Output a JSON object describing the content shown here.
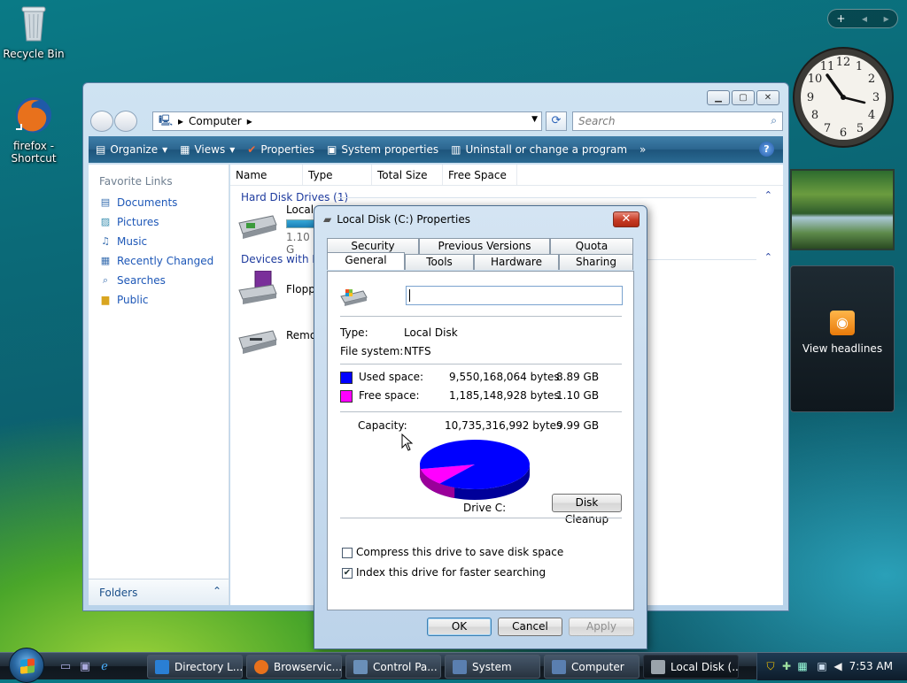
{
  "desktop": {
    "icons": [
      {
        "label": "Recycle Bin"
      },
      {
        "label": "firefox -\nShortcut",
        "line1": "firefox -",
        "line2": "Shortcut"
      }
    ]
  },
  "explorer": {
    "address": {
      "location": "Computer",
      "arrow": "▸"
    },
    "search_placeholder": "Search",
    "toolbar": {
      "organize": "Organize",
      "views": "Views",
      "properties": "Properties",
      "system_properties": "System properties",
      "uninstall": "Uninstall or change a program",
      "more": "»"
    },
    "nav": {
      "header": "Favorite Links",
      "links": [
        "Documents",
        "Pictures",
        "Music",
        "Recently Changed",
        "Searches",
        "Public"
      ],
      "folders": "Folders"
    },
    "columns": [
      "Name",
      "Type",
      "Total Size",
      "Free Space"
    ],
    "groups": [
      {
        "title": "Hard Disk Drives (1)"
      },
      {
        "title": "Devices with Re"
      }
    ],
    "items": [
      {
        "name": "Local",
        "size": "1.10 G",
        "usage": 0.89
      },
      {
        "name": "Floppy"
      },
      {
        "name": "Remov"
      }
    ]
  },
  "dialog": {
    "title": "Local Disk (C:) Properties",
    "tabs_row1": [
      "Security",
      "Previous Versions",
      "Quota"
    ],
    "tabs_row2": [
      "General",
      "Tools",
      "Hardware",
      "Sharing"
    ],
    "active_tab": "General",
    "type_label": "Type:",
    "type_value": "Local Disk",
    "fs_label": "File system:",
    "fs_value": "NTFS",
    "used_label": "Used space:",
    "used_bytes": "9,550,168,064 bytes",
    "used_gb": "8.89 GB",
    "free_label": "Free space:",
    "free_bytes": "1,185,148,928 bytes",
    "free_gb": "1.10 GB",
    "capacity_label": "Capacity:",
    "capacity_bytes": "10,735,316,992 bytes",
    "capacity_gb": "9.99 GB",
    "drive_label": "Drive C:",
    "disk_cleanup": "Disk Cleanup",
    "compress_label": "Compress this drive to save disk space",
    "index_label": "Index this drive for faster searching",
    "compress_checked": false,
    "index_checked": true,
    "ok": "OK",
    "cancel": "Cancel",
    "apply": "Apply",
    "used_color": "#0000ff",
    "free_color": "#ff00ff",
    "used_fraction": 0.8896
  },
  "gadgets": {
    "feed_label": "View headlines"
  },
  "taskbar": {
    "tasks": [
      "Directory L...",
      "Browservic...",
      "Control Pa...",
      "System",
      "Computer",
      "Local Disk (..."
    ],
    "time": "7:53 AM"
  }
}
